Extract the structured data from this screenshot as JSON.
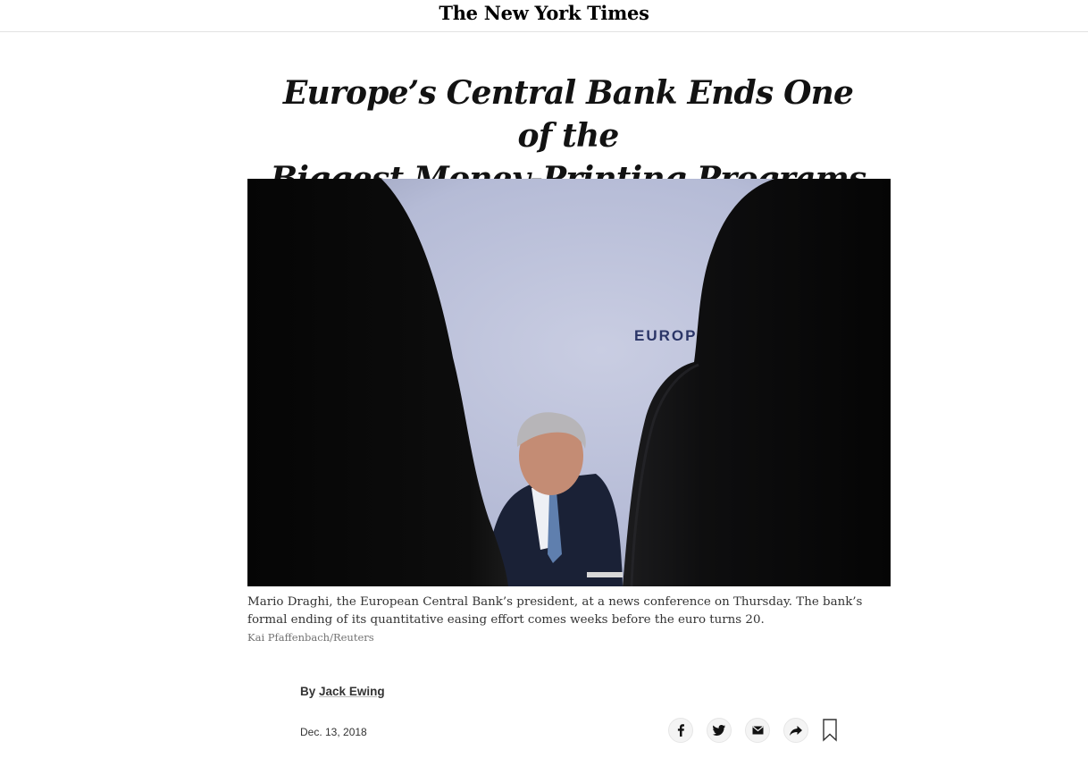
{
  "masthead": {
    "logo_text": "The New York Times"
  },
  "article": {
    "headline_line1": "Europe’s Central Bank Ends One of the",
    "headline_line2": "Biggest Money-Printing Programs Ever",
    "photo": {
      "wall_text": "EUROPE",
      "caption": "Mario Draghi, the European Central Bank’s president, at a news conference on Thursday. The bank’s formal ending of its quantitative easing effort comes weeks before the euro turns 20.",
      "credit": "Kai Pfaffenbach/Reuters"
    },
    "byline_prefix": "By",
    "author": "Jack Ewing",
    "date": "Dec. 13, 2018"
  },
  "share_tools": [
    {
      "icon": "facebook-icon"
    },
    {
      "icon": "twitter-icon"
    },
    {
      "icon": "email-icon"
    },
    {
      "icon": "share-icon"
    },
    {
      "icon": "bookmark-icon"
    }
  ]
}
